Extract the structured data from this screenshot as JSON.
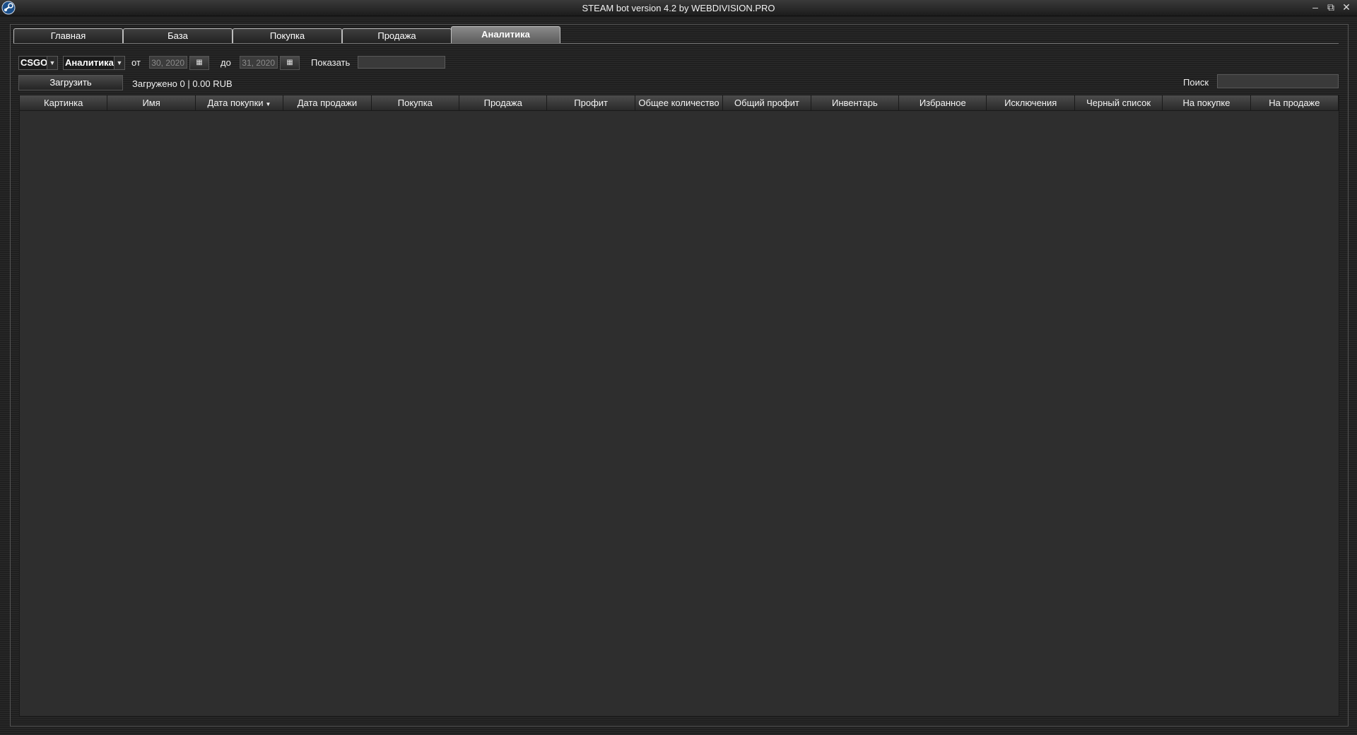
{
  "window": {
    "title": "STEAM bot version 4.2 by WEBDIVISION.PRO",
    "minimize_glyph": "–",
    "restore_glyph": "⧉",
    "close_glyph": "✕"
  },
  "tabs": [
    {
      "label": "Главная"
    },
    {
      "label": "База"
    },
    {
      "label": "Покупка"
    },
    {
      "label": "Продажа"
    },
    {
      "label": "Аналитика",
      "active": true
    }
  ],
  "filters": {
    "game_value": "CSGO",
    "mode_value": "Аналитика",
    "from_label": "от",
    "from_date": "30, 2020",
    "to_label": "до",
    "to_date": "31, 2020",
    "show_label": "Показать",
    "show_value": ""
  },
  "toolbar": {
    "load_button": "Загрузить",
    "status": "Загружено 0 | 0.00 RUB",
    "search_label": "Поиск",
    "search_value": ""
  },
  "table": {
    "columns": [
      "Картинка",
      "Имя",
      "Дата покупки",
      "Дата продажи",
      "Покупка",
      "Продажа",
      "Профит",
      "Общее количество",
      "Общий профит",
      "Инвентарь",
      "Избранное",
      "Исключения",
      "Черный список",
      "На покупке",
      "На продаже"
    ],
    "sorted_column": "Дата покупки",
    "rows": []
  },
  "icons": {
    "app": "steam-logo-icon",
    "calendar": "calendar-icon",
    "dropdown": "chevron-down-icon",
    "sort": "sort-desc-icon"
  },
  "colors": {
    "background": "#262626",
    "active_tab": "#7a7a7a",
    "grid_background": "#2e2e2e"
  }
}
